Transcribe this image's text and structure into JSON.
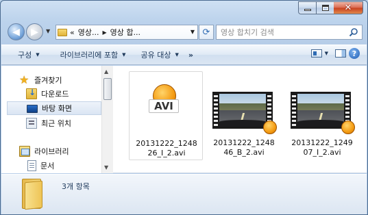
{
  "window": {
    "caption": {
      "minimize": "minimize",
      "maximize": "maximize",
      "close": "✕"
    }
  },
  "nav": {
    "back_glyph": "◀",
    "forward_glyph": "▶",
    "breadcrumb": {
      "prefix": "«",
      "part1": "영상...",
      "part2": "영상 합..."
    },
    "search_placeholder": "영상 합치기 검색"
  },
  "toolbar": {
    "organize": "구성",
    "include_library": "라이브러리에 포함",
    "share": "공유 대상",
    "more": "»",
    "help": "?"
  },
  "navpane": {
    "items": [
      {
        "label": "즐겨찾기",
        "icon": "star-icon"
      },
      {
        "label": "다운로드",
        "icon": "download-folder-icon"
      },
      {
        "label": "바탕 화면",
        "icon": "desktop-icon",
        "selected": true
      },
      {
        "label": "최근 위치",
        "icon": "recent-places-icon"
      },
      {
        "label": "라이브러리",
        "icon": "library-icon"
      },
      {
        "label": "문서",
        "icon": "documents-icon"
      }
    ]
  },
  "files": [
    {
      "name_line1": "20131222_1248",
      "name_line2": "26_I_2.avi",
      "thumb": "avi-icon",
      "badge": "AVI"
    },
    {
      "name_line1": "20131222_1248",
      "name_line2": "46_B_2.avi",
      "thumb": "video-thumbnail"
    },
    {
      "name_line1": "20131222_1249",
      "name_line2": "07_I_2.avi",
      "thumb": "video-thumbnail"
    }
  ],
  "details": {
    "item_count": "3개 항목"
  },
  "colors": {
    "window_frame": "#bcd3ec",
    "accent": "#2e6bb3",
    "close": "#c7401f"
  }
}
